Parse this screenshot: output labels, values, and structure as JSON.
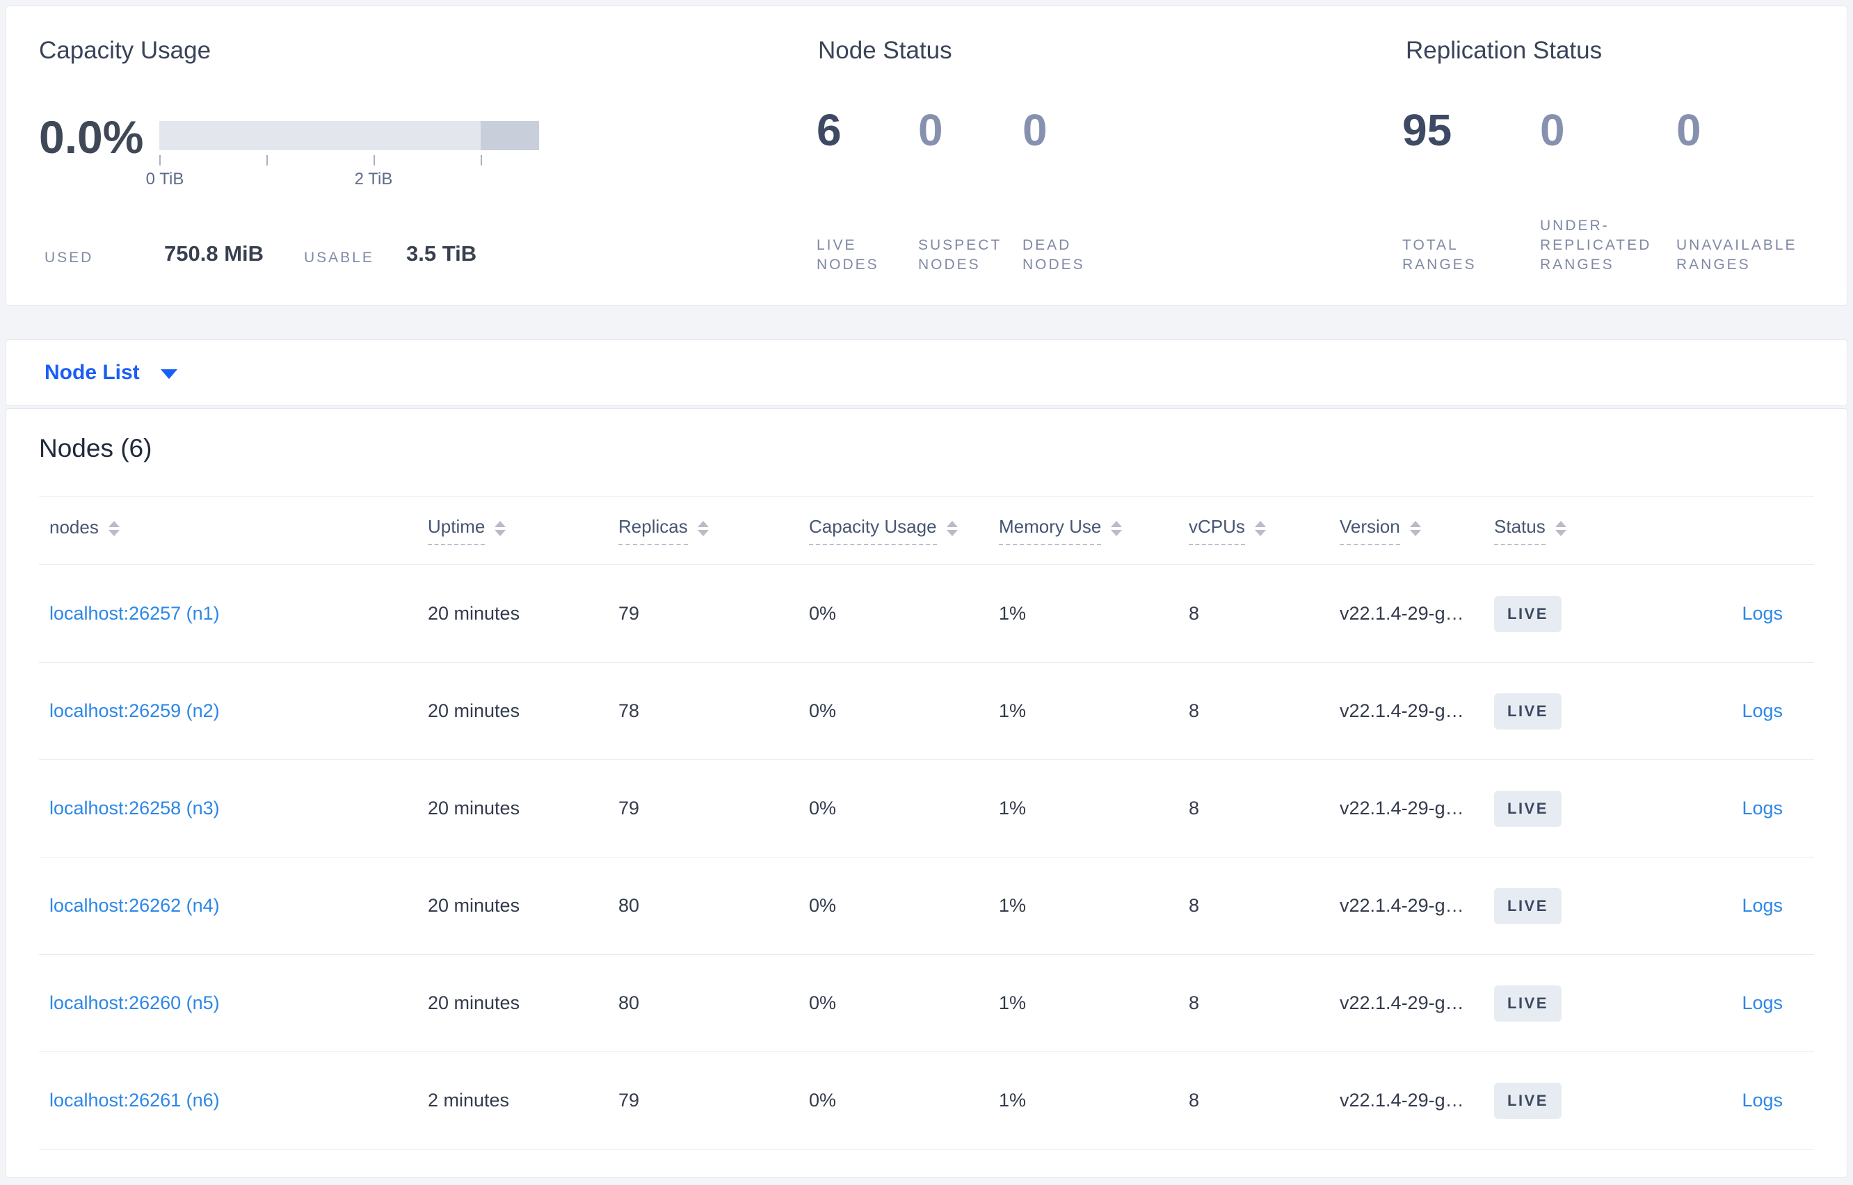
{
  "overview": {
    "capacity_usage": {
      "title": "Capacity Usage",
      "percent_used": "0.0%",
      "tick_labels": [
        "0 TiB",
        "2 TiB"
      ],
      "used_label": "USED",
      "used_value": "750.8 MiB",
      "usable_label": "USABLE",
      "usable_value": "3.5 TiB"
    },
    "node_status": {
      "title": "Node Status",
      "stats": [
        {
          "value": "6",
          "label": "LIVE NODES"
        },
        {
          "value": "0",
          "label": "SUSPECT NODES"
        },
        {
          "value": "0",
          "label": "DEAD NODES"
        }
      ]
    },
    "replication_status": {
      "title": "Replication Status",
      "stats": [
        {
          "value": "95",
          "label": "TOTAL RANGES"
        },
        {
          "value": "0",
          "label": "UNDER-REPLICATED RANGES"
        },
        {
          "value": "0",
          "label": "UNAVAILABLE RANGES"
        }
      ]
    }
  },
  "view_selector": {
    "label": "Node List"
  },
  "nodes_table": {
    "title": "Nodes (6)",
    "columns": [
      "nodes",
      "Uptime",
      "Replicas",
      "Capacity Usage",
      "Memory Use",
      "vCPUs",
      "Version",
      "Status"
    ],
    "rows": [
      {
        "node": "localhost:26257 (n1)",
        "uptime": "20 minutes",
        "replicas": "79",
        "capacity": "0%",
        "memory": "1%",
        "vcpus": "8",
        "version": "v22.1.4-29-g…",
        "status": "LIVE",
        "logs": "Logs"
      },
      {
        "node": "localhost:26259 (n2)",
        "uptime": "20 minutes",
        "replicas": "78",
        "capacity": "0%",
        "memory": "1%",
        "vcpus": "8",
        "version": "v22.1.4-29-g…",
        "status": "LIVE",
        "logs": "Logs"
      },
      {
        "node": "localhost:26258 (n3)",
        "uptime": "20 minutes",
        "replicas": "79",
        "capacity": "0%",
        "memory": "1%",
        "vcpus": "8",
        "version": "v22.1.4-29-g…",
        "status": "LIVE",
        "logs": "Logs"
      },
      {
        "node": "localhost:26262 (n4)",
        "uptime": "20 minutes",
        "replicas": "80",
        "capacity": "0%",
        "memory": "1%",
        "vcpus": "8",
        "version": "v22.1.4-29-g…",
        "status": "LIVE",
        "logs": "Logs"
      },
      {
        "node": "localhost:26260 (n5)",
        "uptime": "20 minutes",
        "replicas": "80",
        "capacity": "0%",
        "memory": "1%",
        "vcpus": "8",
        "version": "v22.1.4-29-g…",
        "status": "LIVE",
        "logs": "Logs"
      },
      {
        "node": "localhost:26261 (n6)",
        "uptime": "2 minutes",
        "replicas": "79",
        "capacity": "0%",
        "memory": "1%",
        "vcpus": "8",
        "version": "v22.1.4-29-g…",
        "status": "LIVE",
        "logs": "Logs"
      }
    ]
  },
  "colors": {
    "page_background": "#f3f4f8",
    "card_background": "#ffffff",
    "accent_blue": "#1a5ef5",
    "link_blue": "#2c87e8",
    "stat_dark": "#3e4a63",
    "stat_light": "#8591ae",
    "label_gray": "#8089a4",
    "bar_light": "#e3e6ed",
    "bar_dark": "#c9cedb",
    "badge_background": "#e7ebf2",
    "badge_text": "#3c4961"
  }
}
